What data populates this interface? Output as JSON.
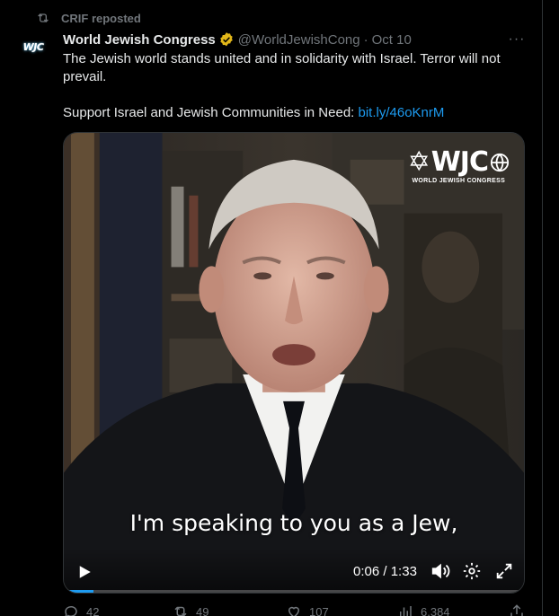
{
  "repost": {
    "label": "CRIF reposted",
    "icon": "repost-icon"
  },
  "avatar": {
    "text": "WJC"
  },
  "author": {
    "name": "World Jewish Congress",
    "handle": "@WorldJewishCong",
    "separator": "·",
    "date": "Oct 10",
    "verified_color": "#e2b719"
  },
  "more_label": "···",
  "tweet": {
    "line1": "The Jewish world stands united and in solidarity with Israel. Terror will not prevail.",
    "line2_prefix": "Support Israel and Jewish Communities in Need: ",
    "link": "bit.ly/46oKnrM"
  },
  "video": {
    "logo": "WJC",
    "logo_sub": "WORLD JEWISH CONGRESS",
    "caption": "I'm speaking to you as a Jew,",
    "current_time": "0:06",
    "duration": "1:33",
    "time_separator": " / ",
    "progress": 0.065,
    "accent": "#1d9bf0"
  },
  "actions": {
    "replies": "42",
    "reposts": "49",
    "likes": "107",
    "views": "6,384"
  },
  "colors": {
    "background": "#000000",
    "text": "#e7e9ea",
    "muted": "#71767b",
    "link": "#1d9bf0"
  }
}
